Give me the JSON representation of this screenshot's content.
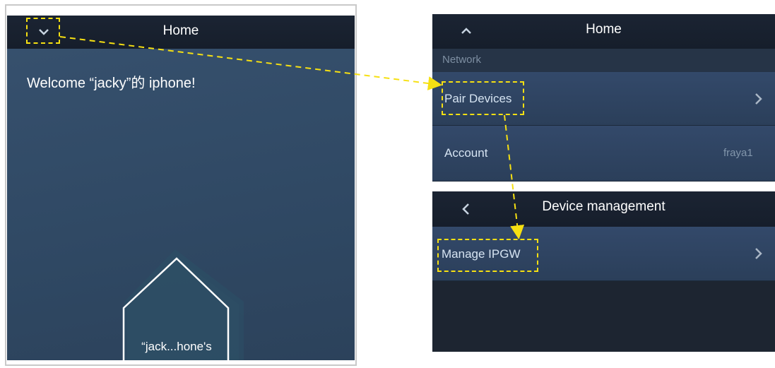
{
  "left_screen": {
    "nav_title": "Home",
    "dropdown_icon": "chevron-down-icon",
    "welcome_text": "Welcome “jacky”的 iphone!",
    "device_label": "“jack...hone's"
  },
  "home_panel": {
    "nav_title": "Home",
    "collapse_icon": "chevron-up-icon",
    "section_label": "Network",
    "rows": [
      {
        "label": "Pair Devices",
        "value": "",
        "icon": "chevron-right-icon"
      },
      {
        "label": "Account",
        "value": "fraya1"
      }
    ]
  },
  "device_panel": {
    "nav_title": "Device management",
    "back_icon": "chevron-left-icon",
    "rows": [
      {
        "label": "Manage IPGW",
        "icon": "chevron-right-icon"
      }
    ]
  },
  "colors": {
    "nav_bar": "#1b2433",
    "body": "#33496a",
    "annotation": "#f6e012"
  }
}
